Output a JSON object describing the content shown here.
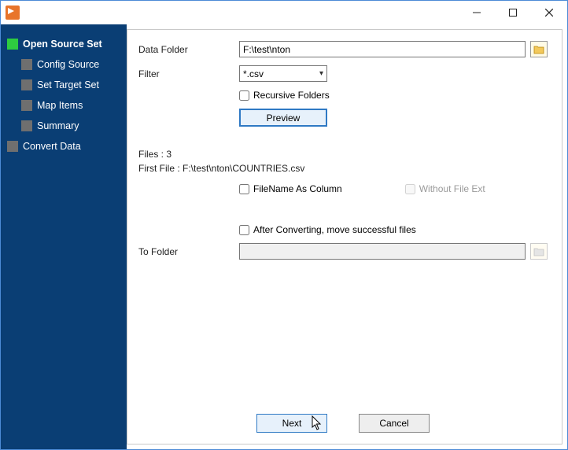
{
  "sidebar": {
    "items": [
      {
        "label": "Open Source Set"
      },
      {
        "label": "Config Source"
      },
      {
        "label": "Set Target Set"
      },
      {
        "label": "Map Items"
      },
      {
        "label": "Summary"
      },
      {
        "label": "Convert Data"
      }
    ]
  },
  "form": {
    "data_folder_label": "Data Folder",
    "data_folder_value": "F:\\test\\nton",
    "filter_label": "Filter",
    "filter_value": "*.csv",
    "recursive_label": "Recursive Folders",
    "preview_label": "Preview",
    "files_label": "Files : 3",
    "first_file_label": "First File : F:\\test\\nton\\COUNTRIES.csv",
    "filename_col_label": "FileName As Column",
    "without_ext_label": "Without File Ext",
    "after_convert_label": "After Converting, move successful files",
    "to_folder_label": "To Folder",
    "to_folder_value": ""
  },
  "footer": {
    "next_label": "Next",
    "cancel_label": "Cancel"
  }
}
